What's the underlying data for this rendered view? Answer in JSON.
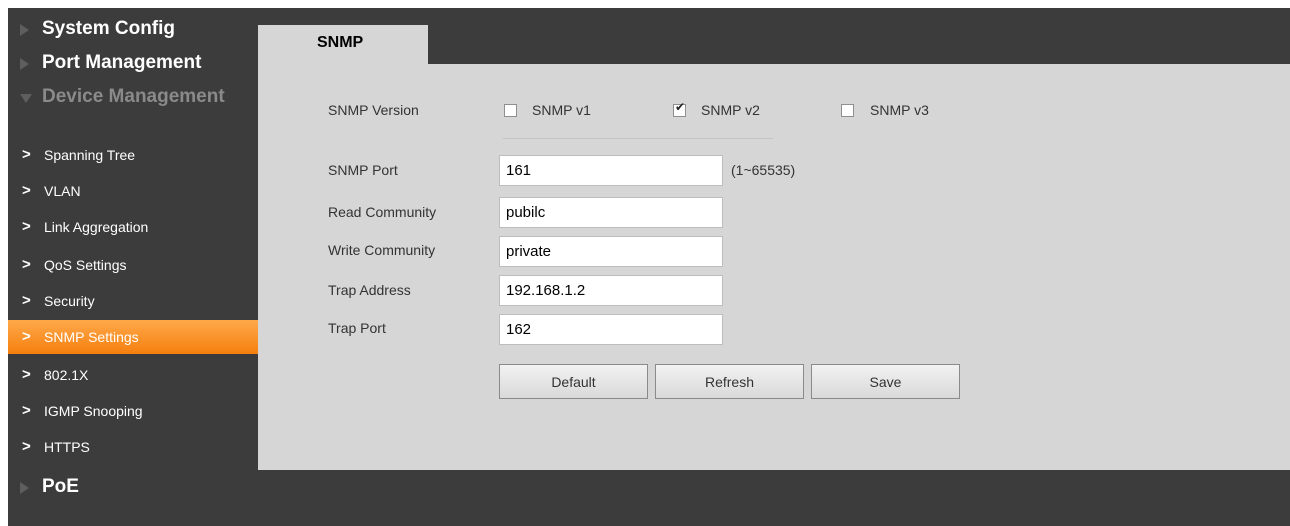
{
  "sidebar": {
    "sections": {
      "system_config": "System Config",
      "port_management": "Port Management",
      "device_management": "Device Management",
      "poe": "PoE"
    },
    "items": [
      {
        "label": "Spanning Tree",
        "active": false
      },
      {
        "label": "VLAN",
        "active": false
      },
      {
        "label": "Link Aggregation",
        "active": false
      },
      {
        "label": "QoS Settings",
        "active": false
      },
      {
        "label": "Security",
        "active": false
      },
      {
        "label": "SNMP Settings",
        "active": true
      },
      {
        "label": "802.1X",
        "active": false
      },
      {
        "label": "IGMP Snooping",
        "active": false
      },
      {
        "label": "HTTPS",
        "active": false
      }
    ]
  },
  "tab": {
    "label": "SNMP"
  },
  "form": {
    "version": {
      "label": "SNMP Version",
      "options": [
        {
          "label": "SNMP v1",
          "checked": false
        },
        {
          "label": "SNMP v2",
          "checked": true
        },
        {
          "label": "SNMP v3",
          "checked": false
        }
      ]
    },
    "port": {
      "label": "SNMP Port",
      "value": "161",
      "range": "(1~65535)"
    },
    "read_community": {
      "label": "Read Community",
      "value": "pubilc"
    },
    "write_community": {
      "label": "Write Community",
      "value": "private"
    },
    "trap_address": {
      "label": "Trap Address",
      "value": "192.168.1.2"
    },
    "trap_port": {
      "label": "Trap Port",
      "value": "162"
    }
  },
  "buttons": {
    "default": "Default",
    "refresh": "Refresh",
    "save": "Save"
  },
  "colors": {
    "active_item": "#f57f0e",
    "sidebar_bg": "#3c3c3c",
    "panel_bg": "#d6d6d6"
  }
}
